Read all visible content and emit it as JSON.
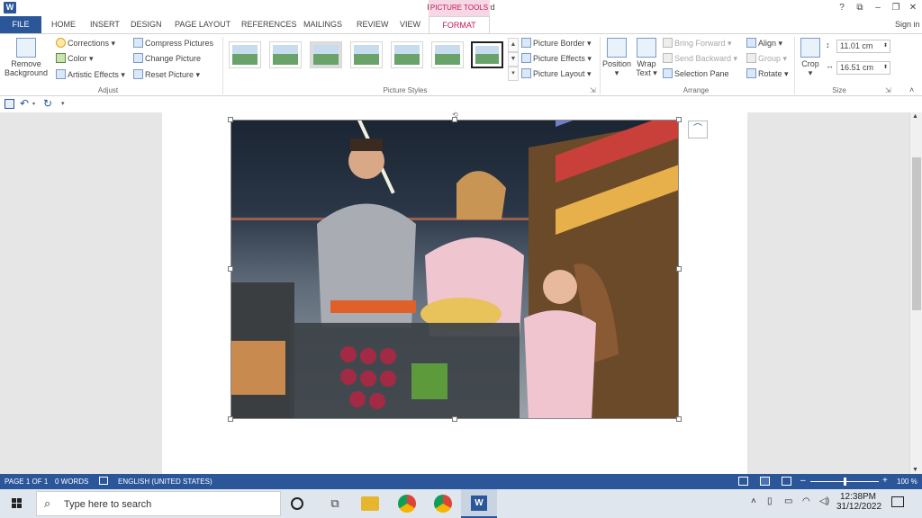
{
  "window": {
    "app_logo": "W",
    "title": "Document1 - Word",
    "contextual_label": "PICTURE TOOLS",
    "buttons": [
      "?",
      "⧉",
      "–",
      "❐",
      "✕"
    ]
  },
  "tabs": {
    "file": "FILE",
    "items": [
      "HOME",
      "INSERT",
      "DESIGN",
      "PAGE LAYOUT",
      "REFERENCES",
      "MAILINGS",
      "REVIEW",
      "VIEW"
    ],
    "active": "FORMAT",
    "sign_in": "Sign in"
  },
  "ribbon": {
    "adjust": {
      "label": "Adjust",
      "remove_background_line1": "Remove",
      "remove_background_line2": "Background",
      "corrections": "Corrections",
      "color": "Color",
      "artistic_effects": "Artistic Effects",
      "compress_pictures": "Compress Pictures",
      "change_picture": "Change Picture",
      "reset_picture": "Reset Picture"
    },
    "picture_styles": {
      "label": "Picture Styles",
      "picture_border": "Picture Border",
      "picture_effects": "Picture Effects",
      "picture_layout": "Picture Layout"
    },
    "arrange": {
      "label": "Arrange",
      "position": "Position",
      "wrap_text_line1": "Wrap",
      "wrap_text_line2": "Text",
      "bring_forward": "Bring Forward",
      "send_backward": "Send Backward",
      "selection_pane": "Selection Pane",
      "align": "Align",
      "group": "Group",
      "rotate": "Rotate"
    },
    "size": {
      "label": "Size",
      "crop": "Crop",
      "height": "11.01 cm",
      "width": "16.51 cm"
    }
  },
  "statusbar": {
    "page": "PAGE 1 OF 1",
    "words": "0 WORDS",
    "language": "ENGLISH (UNITED STATES)",
    "zoom": "100 %",
    "zoom_level": 0.5
  },
  "taskbar": {
    "search_placeholder": "Type here to search",
    "time": "12:38PM",
    "date": "31/12/2022"
  },
  "colors": {
    "word_blue": "#2b579a",
    "picture_tools_pink": "#c2185b"
  }
}
